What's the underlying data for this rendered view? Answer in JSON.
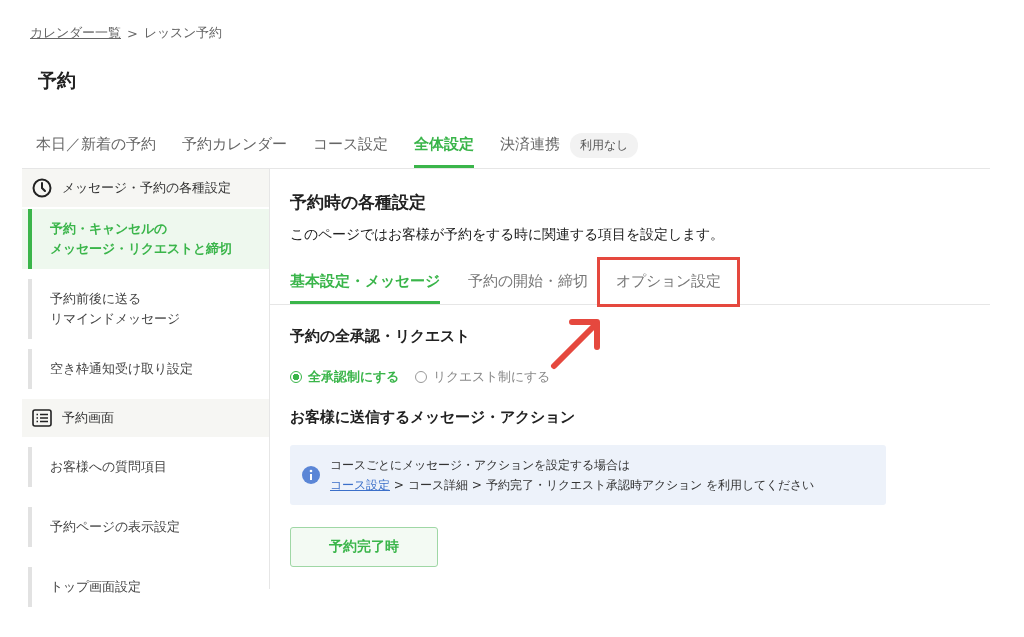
{
  "breadcrumb": {
    "link": "カレンダー一覧",
    "separator": ">",
    "current": "レッスン予約"
  },
  "page_title": "予約",
  "tabs": [
    {
      "label": "本日／新着の予約",
      "selected": false
    },
    {
      "label": "予約カレンダー",
      "selected": false
    },
    {
      "label": "コース設定",
      "selected": false
    },
    {
      "label": "全体設定",
      "selected": true
    },
    {
      "label": "決済連携",
      "selected": false,
      "badge": "利用なし"
    }
  ],
  "sidebar": {
    "groups": [
      {
        "kind": "clock",
        "title": "メッセージ・予約の各種設定",
        "items": [
          {
            "lines": [
              "予約・キャンセルの",
              "メッセージ・リクエストと締切"
            ],
            "selected": true
          },
          {
            "lines": [
              "予約前後に送る",
              "リマインドメッセージ"
            ],
            "selected": false
          },
          {
            "lines": [
              "空き枠通知受け取り設定"
            ],
            "selected": false
          }
        ]
      },
      {
        "kind": "list",
        "title": "予約画面",
        "items": [
          {
            "lines": [
              "お客様への質問項目"
            ],
            "selected": false
          },
          {
            "lines": [
              "予約ページの表示設定"
            ],
            "selected": false
          },
          {
            "lines": [
              "トップ画面設定"
            ],
            "selected": false
          }
        ]
      }
    ]
  },
  "content": {
    "title": "予約時の各種設定",
    "description": "このページではお客様が予約をする時に関連する項目を設定します。",
    "subtabs": [
      {
        "label": "基本設定・メッセージ",
        "selected": true,
        "highlighted": false
      },
      {
        "label": "予約の開始・締切",
        "selected": false,
        "highlighted": false
      },
      {
        "label": "オプション設定",
        "selected": false,
        "highlighted": true
      }
    ],
    "approval": {
      "heading": "予約の全承認・リクエスト",
      "choices": [
        {
          "label": "全承認制にする",
          "selected": true
        },
        {
          "label": "リクエスト制にする",
          "selected": false
        }
      ]
    },
    "messages": {
      "heading": "お客様に送信するメッセージ・アクション",
      "info": {
        "line1": "コースごとにメッセージ・アクションを設定する場合は",
        "link": "コース設定",
        "rest": " > コース詳細 > 予約完了・リクエスト承認時アクション を利用してください"
      },
      "button": "予約完了時"
    }
  }
}
